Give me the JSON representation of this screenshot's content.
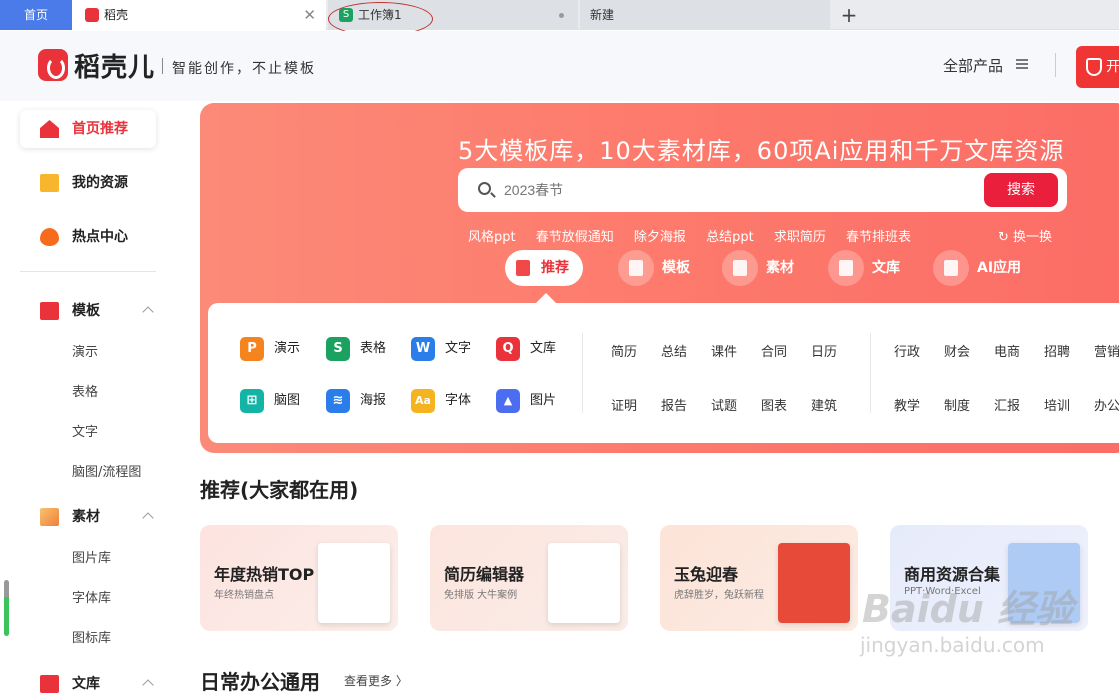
{
  "tabs": {
    "home": "首页",
    "active": "稻壳",
    "sheet": "工作簿1",
    "new": "新建",
    "plus": "+"
  },
  "header": {
    "brand": "稻壳儿",
    "slogan": "智能创作，不止模板",
    "all_products": "全部产品",
    "open_label": "开"
  },
  "sidebar": {
    "nav": [
      {
        "label": "首页推荐"
      },
      {
        "label": "我的资源"
      },
      {
        "label": "热点中心"
      }
    ],
    "template_section": {
      "label": "模板",
      "items": [
        "演示",
        "表格",
        "文字",
        "脑图/流程图"
      ]
    },
    "material_section": {
      "label": "素材",
      "items": [
        "图片库",
        "字体库",
        "图标库"
      ]
    },
    "library_section": {
      "label": "文库"
    }
  },
  "hero": {
    "title": "5大模板库，10大素材库，60项Ai应用和千万文库资源",
    "search_placeholder": "2023春节",
    "search_button": "搜索",
    "hot_words": [
      "风格ppt",
      "春节放假通知",
      "除夕海报",
      "总结ppt",
      "求职简历",
      "春节排班表"
    ],
    "refresh": "换一换",
    "categories": [
      {
        "label": "推荐",
        "active": true
      },
      {
        "label": "模板"
      },
      {
        "label": "素材"
      },
      {
        "label": "文库"
      },
      {
        "label": "AI应用"
      }
    ]
  },
  "apps": [
    {
      "label": "演示",
      "icon": "P",
      "color": "#f5841f"
    },
    {
      "label": "表格",
      "icon": "S",
      "color": "#1ba160"
    },
    {
      "label": "文字",
      "icon": "W",
      "color": "#2b7de9"
    },
    {
      "label": "文库",
      "icon": "Q",
      "color": "#e9323a"
    },
    {
      "label": "脑图",
      "icon": "⊞",
      "color": "#13b3a5"
    },
    {
      "label": "海报",
      "icon": "≋",
      "color": "#2b7de9"
    },
    {
      "label": "字体",
      "icon": "Aa",
      "color": "#f5b31f"
    },
    {
      "label": "图片",
      "icon": "▲",
      "color": "#4b6ef0"
    }
  ],
  "tags_group1": [
    "简历",
    "总结",
    "课件",
    "合同",
    "日历",
    "证明",
    "报告",
    "试题",
    "图表",
    "建筑"
  ],
  "tags_group2": [
    "行政",
    "财会",
    "电商",
    "招聘",
    "营销",
    "教学",
    "制度",
    "汇报",
    "培训",
    "办公"
  ],
  "recommend": {
    "title": "推荐(大家都在用)",
    "cards": [
      {
        "title": "年度热销TOP",
        "sub": "年终热销盘点"
      },
      {
        "title": "简历编辑器",
        "sub": "免排版 大牛案例"
      },
      {
        "title": "玉兔迎春",
        "sub": "虎辞胜岁，兔跃新程"
      },
      {
        "title": "商用资源合集",
        "sub": "PPT·Word·Excel"
      }
    ]
  },
  "daily": {
    "title": "日常办公通用",
    "more": "查看更多 〉"
  },
  "watermark": {
    "main": "Baidu 经验",
    "sub": "jingyan.baidu.com"
  }
}
